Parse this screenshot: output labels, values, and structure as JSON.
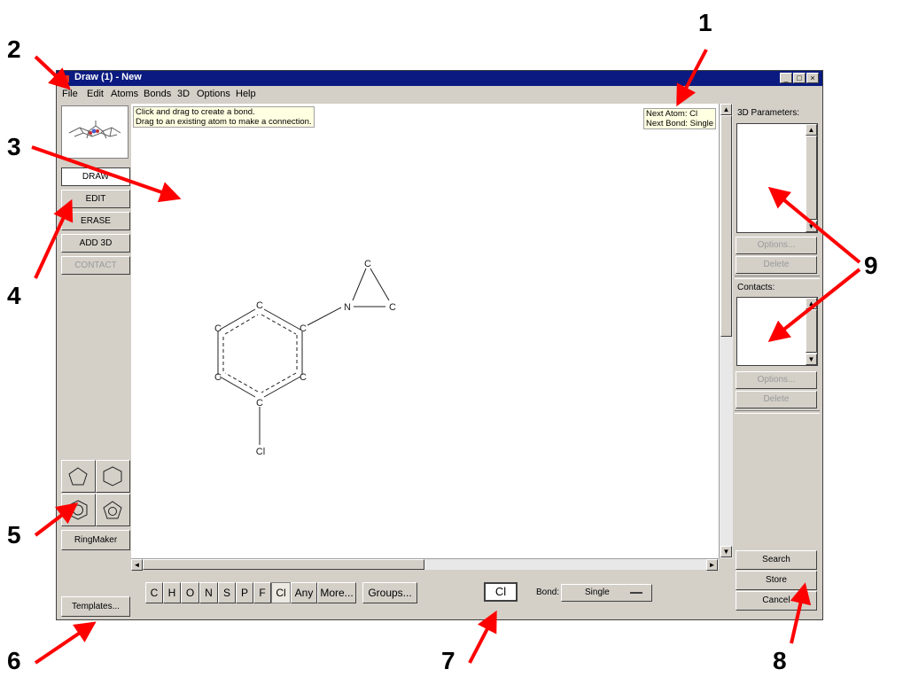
{
  "window": {
    "title": "Draw (1) - New",
    "controls": [
      "_",
      "□",
      "×"
    ]
  },
  "menu": [
    {
      "label": "File"
    },
    {
      "label": "Edit"
    },
    {
      "label": "Atoms"
    },
    {
      "label": "Bonds"
    },
    {
      "label": "3D"
    },
    {
      "label": "Options"
    },
    {
      "label": "Help"
    }
  ],
  "canvas": {
    "hint_line1": "Click and drag to create a bond.",
    "hint_line2": "Drag to an existing atom to make a connection.",
    "next_atom": "Next Atom: Cl",
    "next_bond": "Next Bond: Single"
  },
  "molecule": {
    "atoms": [
      "C",
      "C",
      "C",
      "C",
      "C",
      "C",
      "Cl",
      "N",
      "C",
      "C"
    ]
  },
  "tools": {
    "draw": "DRAW",
    "edit": "EDIT",
    "erase": "ERASE",
    "add3d": "ADD 3D",
    "contact": "CONTACT",
    "ringmaker": "RingMaker",
    "templates": "Templates...",
    "active": "DRAW"
  },
  "elements": [
    "C",
    "H",
    "O",
    "N",
    "S",
    "P",
    "F",
    "Cl",
    "Any",
    "More...",
    "Groups..."
  ],
  "selected_element": "Cl",
  "current_atom": "Cl",
  "bond": {
    "label": "Bond:",
    "value": "Single"
  },
  "right_panel": {
    "params_label": "3D Parameters:",
    "contacts_label": "Contacts:",
    "options": "Options...",
    "delete": "Delete",
    "search": "Search",
    "store": "Store",
    "cancel": "Cancel"
  },
  "callouts": [
    "1",
    "2",
    "3",
    "4",
    "5",
    "6",
    "7",
    "8",
    "9"
  ],
  "colors": {
    "titlebar": "#0a1a80",
    "panel": "#d4d0c8",
    "tooltip": "#ffffe1",
    "arrow": "#ff0000"
  }
}
